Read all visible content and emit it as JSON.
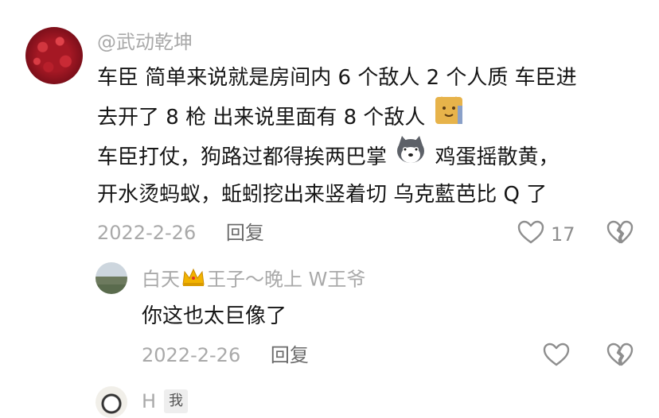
{
  "comment": {
    "username": "@武动乾坤",
    "lines": [
      "车臣 简单来说就是房间内 6 个敌人 2 个人质 车臣进",
      "去开了 8 枪 出来说里面有 8 个敌人",
      "车臣打仗，狗路过都得挨两巴掌",
      "鸡蛋摇散黄，",
      "开水烫蚂蚁，蚯蚓挖出来竖着切 乌克藍芭比 Q 了"
    ],
    "date": "2022-2-26",
    "reply_label": "回复",
    "likes": "17",
    "icons": {
      "emoji1": "cat-face-emoji",
      "emoji2": "husky-emoji",
      "like": "heart-outline-icon",
      "dislike": "broken-heart-icon"
    }
  },
  "reply1": {
    "username_part1": "白天",
    "username_part2": "王子～晚上 W王爷",
    "content": "你这也太巨像了",
    "date": "2022-2-26",
    "reply_label": "回复"
  },
  "reply2": {
    "username": "H",
    "tag": "我"
  }
}
